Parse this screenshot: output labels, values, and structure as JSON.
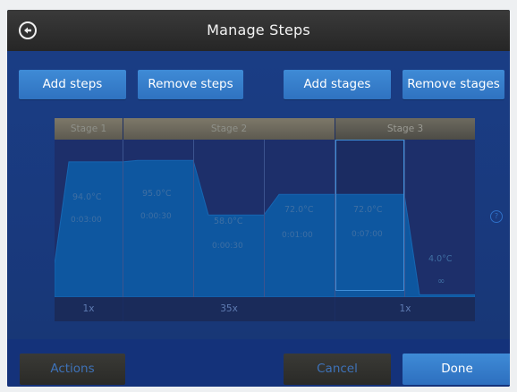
{
  "header": {
    "title": "Manage Steps",
    "back_icon": "back-arrow-icon"
  },
  "toolbar": {
    "add_steps": "Add steps",
    "remove_steps": "Remove steps",
    "add_stages": "Add stages",
    "remove_stages": "Remove stages"
  },
  "stages": [
    {
      "label": "Stage 1",
      "cycles": "1x",
      "selected": false
    },
    {
      "label": "Stage 2",
      "cycles": "35x",
      "selected": false
    },
    {
      "label": "Stage 3",
      "cycles": "1x",
      "selected": true
    }
  ],
  "steps": [
    {
      "stage": 1,
      "temp": "94.0°C",
      "time": "0:03:00",
      "temp_c": 94.0
    },
    {
      "stage": 2,
      "temp": "95.0°C",
      "time": "0:00:30",
      "temp_c": 95.0
    },
    {
      "stage": 2,
      "temp": "58.0°C",
      "time": "0:00:30",
      "temp_c": 58.0
    },
    {
      "stage": 2,
      "temp": "72.0°C",
      "time": "0:01:00",
      "temp_c": 72.0
    },
    {
      "stage": 3,
      "temp": "72.0°C",
      "time": "0:07:00",
      "temp_c": 72.0,
      "selected": true
    },
    {
      "stage": 3,
      "temp": "4.0°C",
      "time": "∞",
      "temp_c": 4.0
    }
  ],
  "footer": {
    "actions": "Actions",
    "cancel": "Cancel",
    "done": "Done"
  },
  "colors": {
    "accent": "#3a85d2",
    "background": "#1a3e86",
    "profile_fill": "#0e57a0"
  }
}
